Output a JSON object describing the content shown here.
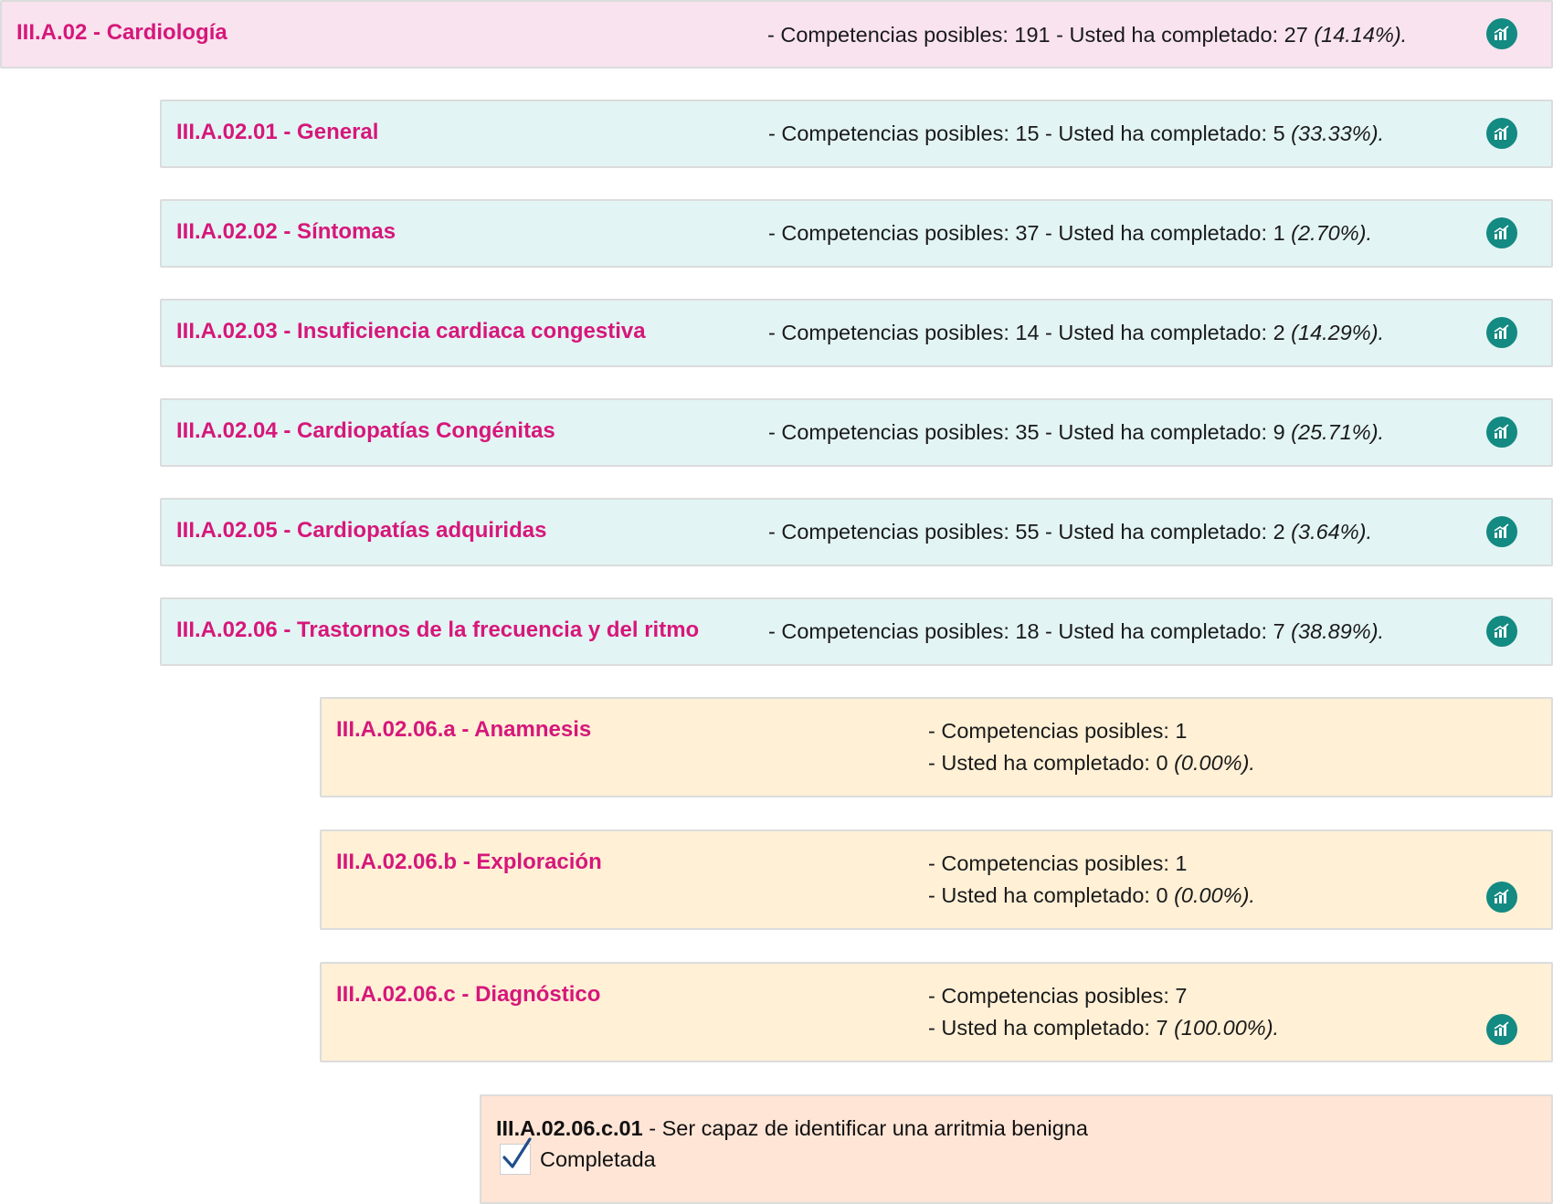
{
  "labels": {
    "posibles_prefix": "- Competencias posibles: ",
    "completado_mid": " - Usted ha completado: ",
    "completado_prefix": "- Usted ha completado: "
  },
  "items": [
    {
      "code": "III.A.02",
      "name": "Cardiología",
      "title": "III.A.02 - Cardiología",
      "posibles": "191",
      "completado": "27",
      "pct": "(14.14%).",
      "level": 0,
      "has_chart": true
    },
    {
      "code": "III.A.02.01",
      "name": "General",
      "title": "III.A.02.01 - General",
      "posibles": "15",
      "completado": "5",
      "pct": "(33.33%).",
      "level": 1,
      "has_chart": true
    },
    {
      "code": "III.A.02.02",
      "name": "Síntomas",
      "title": "III.A.02.02 - Síntomas",
      "posibles": "37",
      "completado": "1",
      "pct": "(2.70%).",
      "level": 1,
      "has_chart": true
    },
    {
      "code": "III.A.02.03",
      "name": "Insuficiencia cardiaca congestiva",
      "title": "III.A.02.03 - Insuficiencia cardiaca congestiva",
      "posibles": "14",
      "completado": "2",
      "pct": "(14.29%).",
      "level": 1,
      "has_chart": true
    },
    {
      "code": "III.A.02.04",
      "name": "Cardiopatías Congénitas",
      "title": "III.A.02.04 - Cardiopatías Congénitas",
      "posibles": "35",
      "completado": "9",
      "pct": "(25.71%).",
      "level": 1,
      "has_chart": true
    },
    {
      "code": "III.A.02.05",
      "name": "Cardiopatías adquiridas",
      "title": "III.A.02.05 - Cardiopatías adquiridas",
      "posibles": "55",
      "completado": "2",
      "pct": "(3.64%).",
      "level": 1,
      "has_chart": true
    },
    {
      "code": "III.A.02.06",
      "name": "Trastornos de la frecuencia y del ritmo",
      "title": "III.A.02.06 - Trastornos de la frecuencia y del ritmo",
      "posibles": "18",
      "completado": "7",
      "pct": "(38.89%).",
      "level": 1,
      "has_chart": true
    },
    {
      "code": "III.A.02.06.a",
      "name": "Anamnesis",
      "title": "III.A.02.06.a - Anamnesis",
      "posibles": "1",
      "completado": "0",
      "pct": "(0.00%).",
      "level": 2,
      "has_chart": false
    },
    {
      "code": "III.A.02.06.b",
      "name": "Exploración",
      "title": "III.A.02.06.b - Exploración",
      "posibles": "1",
      "completado": "0",
      "pct": "(0.00%).",
      "level": 2,
      "has_chart": true
    },
    {
      "code": "III.A.02.06.c",
      "name": "Diagnóstico",
      "title": "III.A.02.06.c - Diagnóstico",
      "posibles": "7",
      "completado": "7",
      "pct": "(100.00%).",
      "level": 2,
      "has_chart": true
    }
  ],
  "leaf": {
    "code": "III.A.02.06.c.01",
    "description": " - Ser capaz de identificar una arritmia benigna",
    "status": "Completada"
  },
  "colors": {
    "title": "#d6177a",
    "chart_icon": "#138a82",
    "level0_bg": "#f8e3ee",
    "level1_bg": "#e3f4f4",
    "level2_bg": "#fff0d6",
    "leaf_bg": "#ffe5d6",
    "check": "#1f4e8c"
  },
  "icons": {
    "chart": "bar-chart-icon",
    "check": "checkmark-icon"
  }
}
